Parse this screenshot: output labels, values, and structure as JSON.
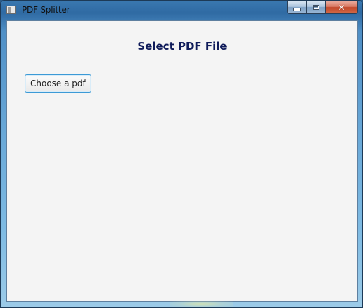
{
  "window": {
    "title": "PDF Splitter",
    "icon": "app-window-icon",
    "controls": {
      "minimize_icon": "minimize-icon",
      "maximize_icon": "maximize-icon",
      "close_icon": "close-icon",
      "close_glyph": "✕"
    }
  },
  "main": {
    "heading": "Select PDF File",
    "choose_button_label": "Choose a pdf"
  },
  "colors": {
    "heading": "#0f1b5a",
    "client_background": "#f4f4f4",
    "button_focus_border": "#3c9ad6"
  }
}
